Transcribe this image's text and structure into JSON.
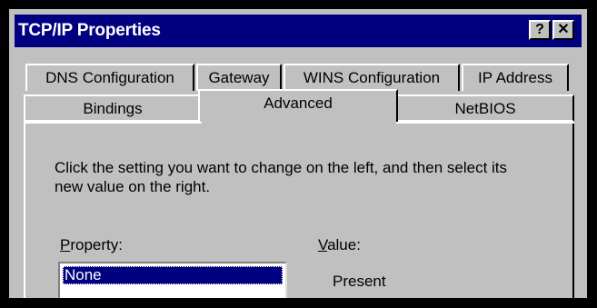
{
  "window": {
    "title": "TCP/IP Properties",
    "help_glyph": "?",
    "close_glyph": "✕"
  },
  "tabs": {
    "row1": [
      {
        "label": "DNS Configuration"
      },
      {
        "label": "Gateway"
      },
      {
        "label": "WINS Configuration"
      },
      {
        "label": "IP Address"
      }
    ],
    "row2": [
      {
        "label": "Bindings"
      },
      {
        "label": "Advanced",
        "active": true
      },
      {
        "label": "NetBIOS"
      }
    ]
  },
  "panel": {
    "instructions": "Click the setting you want to change on the left, and then select its new value on the right.",
    "property_label_accel": "P",
    "property_label_rest": "roperty:",
    "value_label_accel": "V",
    "value_label_rest": "alue:",
    "property_list": [
      {
        "label": "None",
        "selected": true
      }
    ],
    "value": "Present"
  },
  "colors": {
    "titlebar": "#000080",
    "face": "#c0c0c0",
    "selection": "#000080"
  }
}
